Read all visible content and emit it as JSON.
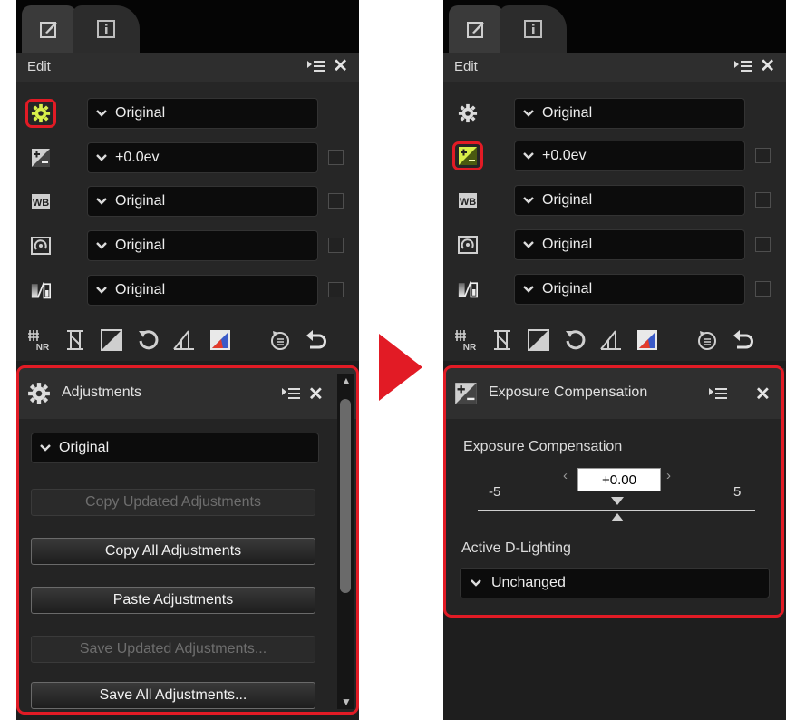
{
  "colors": {
    "accent": "#e21b25",
    "icon_highlight": "#d8f04a",
    "panel": "#1e1e1e"
  },
  "left": {
    "tabs": [
      {
        "icon": "edit-tab-icon"
      },
      {
        "icon": "info-tab-icon"
      }
    ],
    "edit_panel": {
      "title": "Edit",
      "rows": [
        {
          "icon": "gear-icon",
          "value": "Original",
          "has_checkbox": false,
          "highlighted": true
        },
        {
          "icon": "exposure-icon",
          "value": "+0.0ev",
          "has_checkbox": true,
          "highlighted": false
        },
        {
          "icon": "wb-icon",
          "value": "Original",
          "has_checkbox": true,
          "highlighted": false
        },
        {
          "icon": "picture-control-icon",
          "value": "Original",
          "has_checkbox": true,
          "highlighted": false
        },
        {
          "icon": "tone-icon",
          "value": "Original",
          "has_checkbox": true,
          "highlighted": false
        }
      ]
    },
    "adjustments_panel": {
      "title": "Adjustments",
      "dropdown_value": "Original",
      "buttons": [
        {
          "label": "Copy Updated Adjustments",
          "enabled": false
        },
        {
          "label": "Copy All Adjustments",
          "enabled": true
        },
        {
          "label": "Paste Adjustments",
          "enabled": true
        },
        {
          "label": "Save Updated Adjustments...",
          "enabled": false
        },
        {
          "label": "Save All Adjustments...",
          "enabled": true
        }
      ]
    }
  },
  "right": {
    "edit_panel": {
      "title": "Edit",
      "rows": [
        {
          "icon": "gear-icon",
          "value": "Original",
          "has_checkbox": false,
          "highlighted": false
        },
        {
          "icon": "exposure-icon",
          "value": "+0.0ev",
          "has_checkbox": true,
          "highlighted": true
        },
        {
          "icon": "wb-icon",
          "value": "Original",
          "has_checkbox": true,
          "highlighted": false
        },
        {
          "icon": "picture-control-icon",
          "value": "Original",
          "has_checkbox": true,
          "highlighted": false
        },
        {
          "icon": "tone-icon",
          "value": "Original",
          "has_checkbox": true,
          "highlighted": false
        }
      ]
    },
    "exposure_panel": {
      "title": "Exposure Compensation",
      "section_label": "Exposure Compensation",
      "value": "+0.00",
      "min_label": "-5",
      "max_label": "5",
      "slider_value": 0,
      "adl_label": "Active D-Lighting",
      "adl_value": "Unchanged"
    }
  },
  "icons": {
    "menu": "list-menu-icon",
    "close": "✕",
    "tools": [
      "noise-reduction-icon",
      "crop-icon",
      "levels-icon",
      "rotate-icon",
      "straighten-icon",
      "color-balance-icon",
      "retouch-history-icon",
      "undo-icon"
    ]
  }
}
